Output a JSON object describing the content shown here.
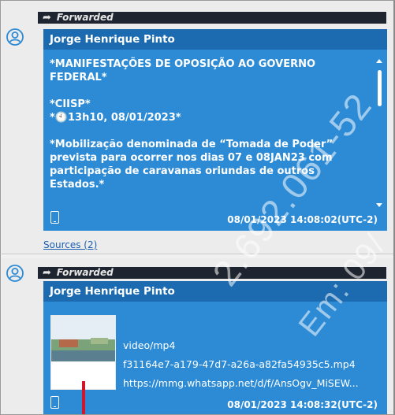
{
  "messages": [
    {
      "forwarded_label": "Forwarded",
      "sender": "Jorge Henrique Pinto",
      "text": "*MANIFESTAÇÕES DE OPOSIÇÃO AO GOVERNO FEDERAL*\n\n*CIISP*\n*🕙13h10, 08/01/2023*\n\n*Mobilização denominada de “Tomada de Poder” prevista para ocorrer nos dias 07 e 08JAN23 com participação de caravanas oriundas de outros Estados.*",
      "timestamp": "08/01/2023 14:08:02(UTC-2)",
      "sources_label": "Sources (2)"
    },
    {
      "forwarded_label": "Forwarded",
      "sender": "Jorge Henrique Pinto",
      "attachment": {
        "mime": "video/mp4",
        "filename": "f31164e7-a179-47d7-a26a-a82fa54935c5.mp4",
        "url": "https://mmg.whatsapp.net/d/f/AnsOgv_MiSEW..."
      },
      "timestamp": "08/01/2023 14:08:32(UTC-2)"
    }
  ],
  "watermark": {
    "line1": "2.692.061-52",
    "line2": "Em: 09/"
  },
  "colors": {
    "bubble": "#2d8bd6",
    "sender_bar": "#1c6bb0",
    "forwarded_bar": "#1f2530",
    "link": "#1a5fb4"
  }
}
